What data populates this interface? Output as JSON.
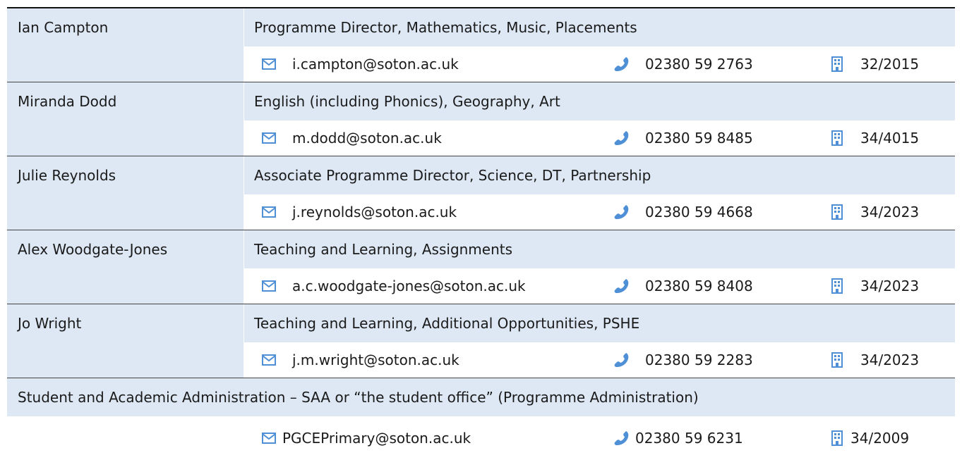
{
  "icons": {
    "email": "envelope-icon",
    "phone": "phone-handset-icon",
    "room": "building-icon"
  },
  "colors": {
    "row_fill": "#dde8f4",
    "icon_blue": "#4f8fd6"
  },
  "staff": [
    {
      "name": "Ian Campton",
      "roles": "Programme Director, Mathematics, Music, Placements",
      "email": "i.campton@soton.ac.uk",
      "phone": "02380 59 2763",
      "room": "32/2015"
    },
    {
      "name": "Miranda Dodd",
      "roles": "English (including Phonics), Geography, Art",
      "email": "m.dodd@soton.ac.uk",
      "phone": "02380 59 8485",
      "room": "34/4015"
    },
    {
      "name": "Julie Reynolds",
      "roles": "Associate Programme Director, Science, DT, Partnership",
      "email": "j.reynolds@soton.ac.uk",
      "phone": "02380 59 4668",
      "room": "34/2023"
    },
    {
      "name": "Alex Woodgate-Jones",
      "roles": "Teaching and Learning, Assignments",
      "email": "a.c.woodgate-jones@soton.ac.uk",
      "phone": "02380 59 8408",
      "room": "34/2023"
    },
    {
      "name": "Jo Wright",
      "roles": "Teaching and Learning, Additional Opportunities, PSHE",
      "email": "j.m.wright@soton.ac.uk",
      "phone": "02380 59 2283",
      "room": "34/2023"
    }
  ],
  "office": {
    "title": "Student and Academic Administration – SAA or “the student office” (Programme Administration)",
    "email": "PGCEPrimary@soton.ac.uk",
    "phone": "02380 59 6231",
    "room": "34/2009"
  }
}
